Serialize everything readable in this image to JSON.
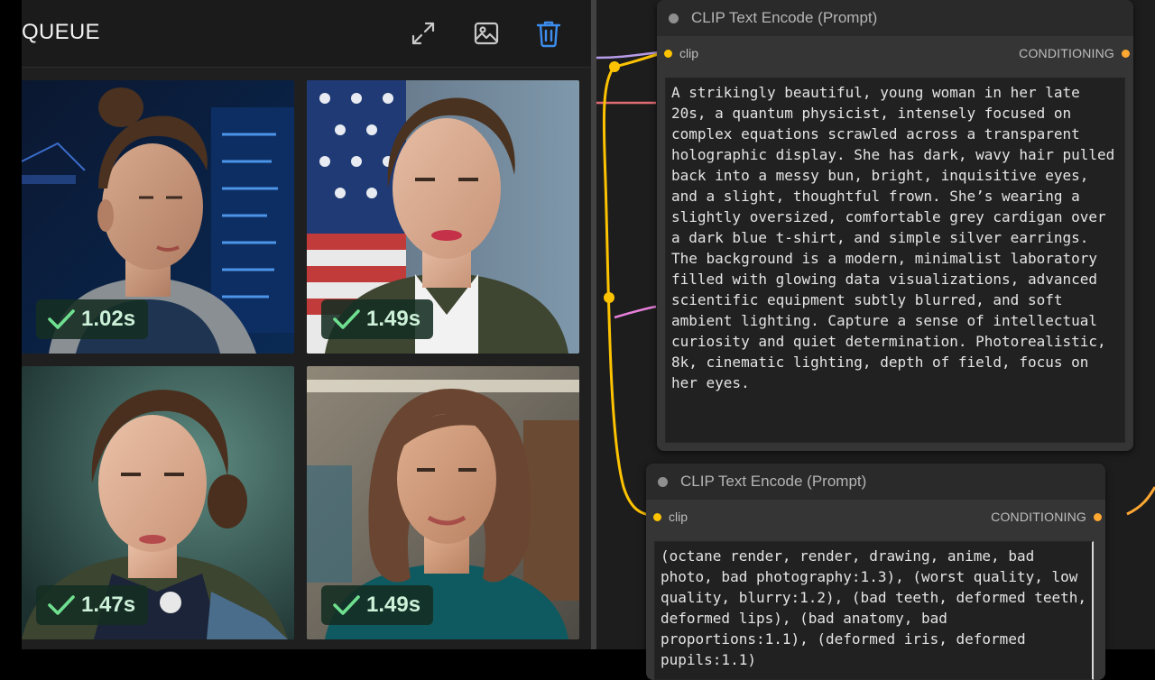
{
  "queue": {
    "title": "QUEUE",
    "icons": {
      "expand": "expand-icon",
      "gallery": "image-icon",
      "clear": "trash-icon"
    },
    "accent_color": "#3d8ef0",
    "items": [
      {
        "time": "1.02s",
        "status": "complete"
      },
      {
        "time": "1.49s",
        "status": "complete"
      },
      {
        "time": "1.47s",
        "status": "complete"
      },
      {
        "time": "1.49s",
        "status": "complete"
      }
    ]
  },
  "nodes": [
    {
      "title": "CLIP Text Encode (Prompt)",
      "input_label": "clip",
      "output_label": "CONDITIONING",
      "text": "A strikingly beautiful, young woman in her late 20s, a quantum physicist, intensely focused on complex equations scrawled across a transparent holographic display. She has dark, wavy hair pulled back into a messy bun, bright, inquisitive eyes, and a slight, thoughtful frown. She’s wearing a slightly oversized, comfortable grey cardigan over a dark blue t-shirt, and simple silver earrings. The background is a modern, minimalist laboratory filled with glowing data visualizations, advanced scientific equipment subtly blurred, and soft ambient lighting. Capture a sense of intellectual curiosity and quiet determination. Photorealistic, 8k, cinematic lighting, depth of field, focus on her eyes."
    },
    {
      "title": "CLIP Text Encode (Prompt)",
      "input_label": "clip",
      "output_label": "CONDITIONING",
      "text": "(octane render, render, drawing, anime, bad photo, bad photography:1.3), (worst quality, low quality, blurry:1.2), (bad teeth, deformed teeth, deformed lips), (bad anatomy, bad proportions:1.1), (deformed iris, deformed pupils:1.1)"
    }
  ],
  "colors": {
    "clip_port": "#fdc300",
    "conditioning_port": "#ffa832",
    "badge_check": "#6fe08f"
  }
}
